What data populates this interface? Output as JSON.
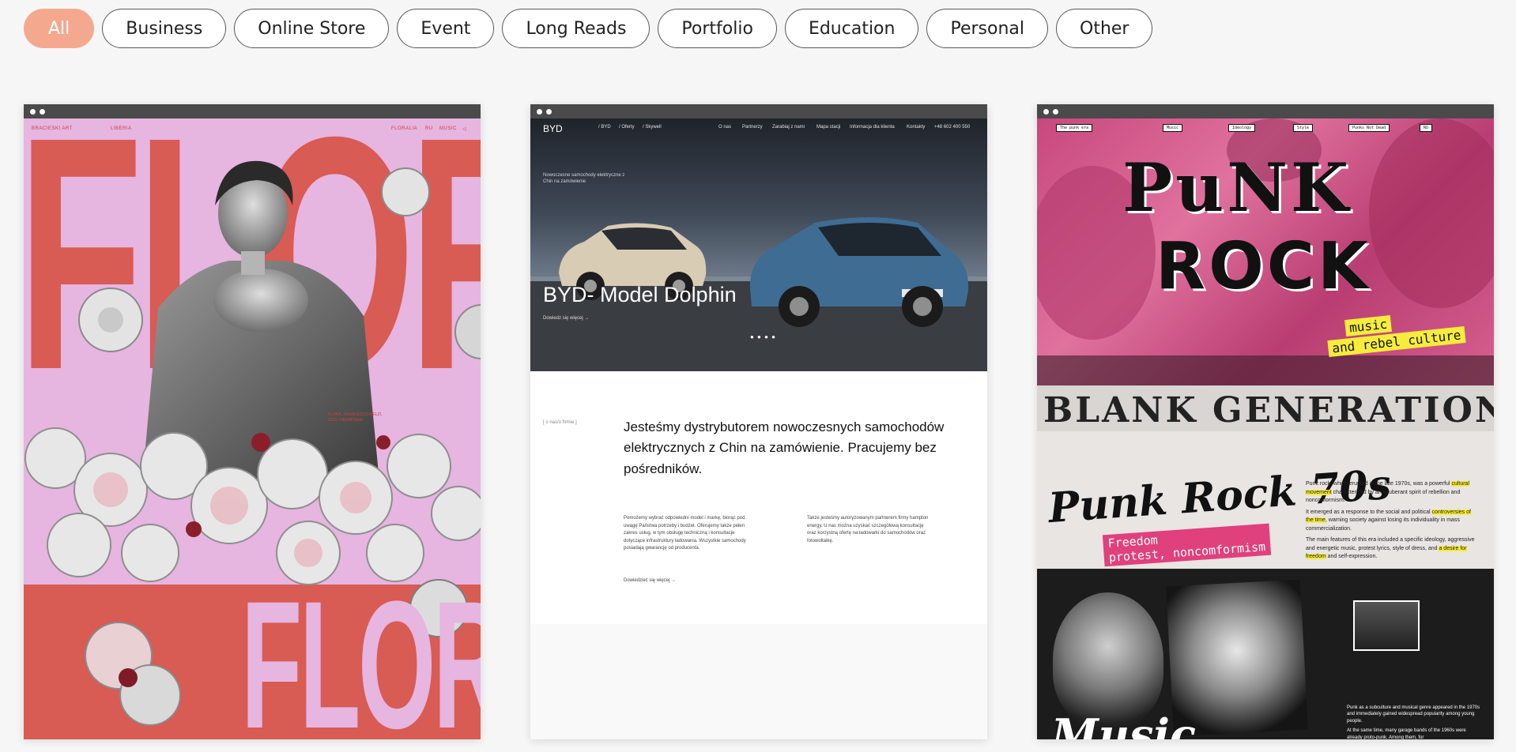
{
  "filters": [
    {
      "label": "All",
      "active": true
    },
    {
      "label": "Business"
    },
    {
      "label": "Online Store"
    },
    {
      "label": "Event"
    },
    {
      "label": "Long Reads"
    },
    {
      "label": "Portfolio"
    },
    {
      "label": "Education"
    },
    {
      "label": "Personal"
    },
    {
      "label": "Other"
    }
  ],
  "flora": {
    "nav": [
      "BRACIESKI ART",
      "LIBERIA",
      "FLORALIA",
      "RU",
      "MUSIC"
    ],
    "big_top": "FLORA",
    "big_bottom": "FLORA",
    "caption": "FLORA, FRANCESCO MELZI, 1510 / HERMITAGE"
  },
  "byd": {
    "logo": "BYD",
    "nav": [
      "/ BYD",
      "/ Oferty",
      "/ Skywell",
      "O nas",
      "Partnerzy",
      "Zarabiaj z nami",
      "Mapa stacji",
      "Informacja dla klienta",
      "Kontakty",
      "+48 602 400 550"
    ],
    "tagline": "Nowoczesne samochody elektryczne z Chin na zamówienie",
    "hero_title": "BYD- Model Dolphin",
    "hero_link": "Dowiedz się więcej   →",
    "dots": "● ● ● ●",
    "section_tag": "[ o nas/o firmie ]",
    "lead": "Jesteśmy dystrybutorem nowoczesnych samochodów elektrycznych z Chin na zamówienie. Pracujemy bez pośredników.",
    "col1": "Pomożemy wybrać odpowiedni model i markę, biorąc pod uwagę Państwa potrzeby i budżet. Oferujemy także pełen zakres usług, w tym obsługę techniczną i konsultacje dotyczące infrastruktury ładowania. Wszystkie samochody posiadają gwarancję od producenta.",
    "col2": "Także jesteśmy autoryzowanym partnerem firmy hampton energy. U nas można uzyskać szczegółową konsultację oraz korzystną ofertę na ładowarki do samochodów oraz fotowoltaikę.",
    "more": "Dowiedzieć się więcej   →"
  },
  "punk": {
    "nav": [
      "The punk era",
      "Music",
      "Ideology",
      "Style",
      "Punks Not Dead",
      "RU"
    ],
    "title1": "PuNK",
    "title2": "ROCK",
    "tag1": "music",
    "tag2": "and rebel culture",
    "blank": "BLANK GENERATION",
    "script": "Punk Rock 70s",
    "pinktag": "Freedom\nprotest, noncomformism",
    "para1_a": "Punk rock, which erupted in the late 1970s, was a powerful ",
    "para1_hl": "cultural movement",
    "para1_b": " characterized by an exuberant spirit of rebellion and nonconformism.",
    "para2_a": "It emerged as a response to the social and political ",
    "para2_hl": "controversies of the time",
    "para2_b": ", warning society against losing its individuality in mass commercialization.",
    "para3_a": "The main features of this era included a specific ideology, aggressive and energetic music, protest lyrics, style of dress, and ",
    "para3_hl": "a desire for freedom",
    "para3_b": " and self-expression.",
    "music": "Music",
    "box1": "Punk as a subculture and musical genre appeared in the 1970s and immediately gained widespread popularity among young people.",
    "box2": "At the same time, many garage bands of the 1960s were already proto-punk. Among them, for"
  },
  "colors": {
    "accent": "#f4a98f",
    "flora_red": "#d85b54",
    "flora_pink": "#e6b5e0",
    "punk_pink": "#d6608f",
    "highlight": "#f6ec3c"
  }
}
